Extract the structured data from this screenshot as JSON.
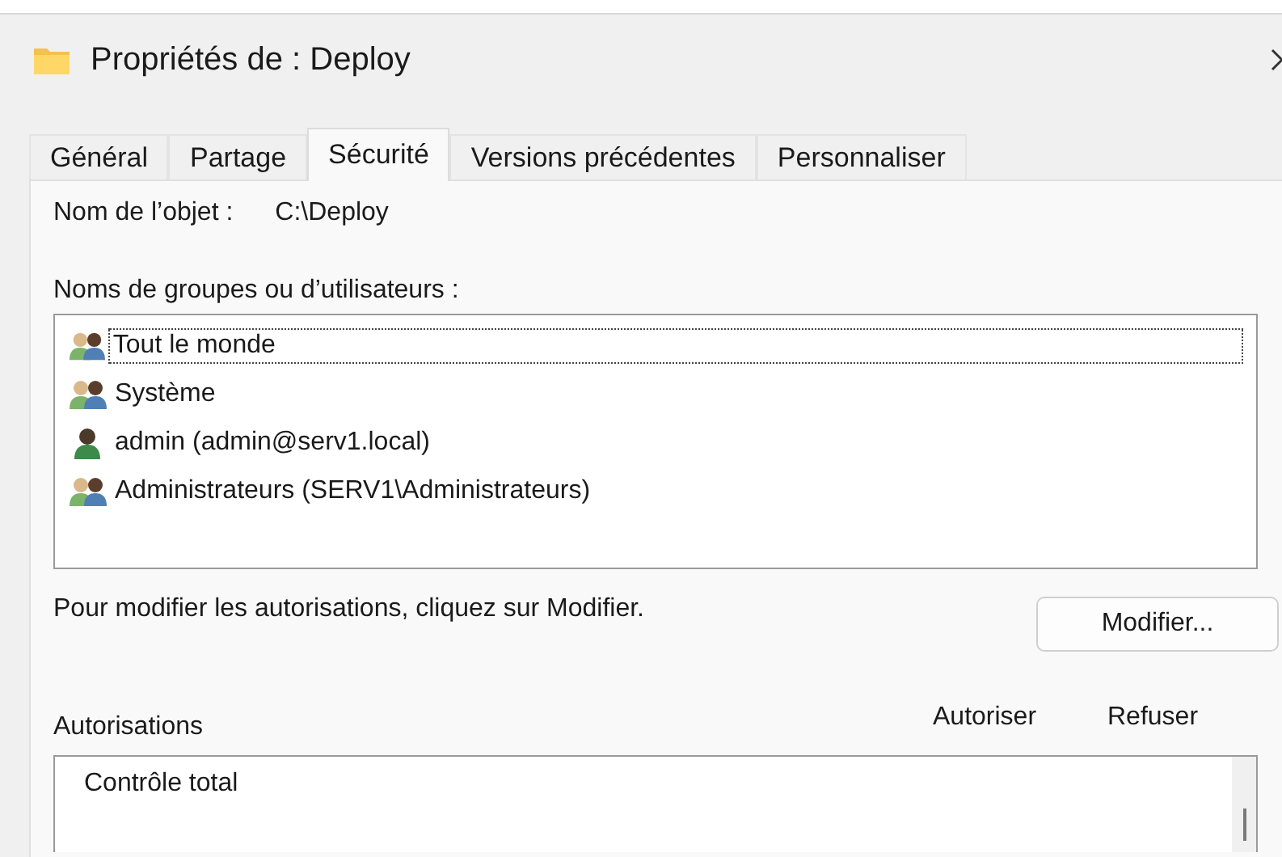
{
  "window": {
    "title": "Propriétés de : Deploy"
  },
  "tabs": [
    {
      "label": "Général",
      "selected": false
    },
    {
      "label": "Partage",
      "selected": false
    },
    {
      "label": "Sécurité",
      "selected": true
    },
    {
      "label": "Versions précédentes",
      "selected": false
    },
    {
      "label": "Personnaliser",
      "selected": false
    }
  ],
  "object_name": {
    "label": "Nom de l’objet :",
    "value": "C:\\Deploy"
  },
  "principals": {
    "label": "Noms de groupes ou d’utilisateurs :",
    "items": [
      {
        "name": "Tout le monde",
        "kind": "group",
        "selected": true
      },
      {
        "name": "Système",
        "kind": "group",
        "selected": false
      },
      {
        "name": "admin (admin@serv1.local)",
        "kind": "user",
        "selected": false
      },
      {
        "name": "Administrateurs (SERV1\\Administrateurs)",
        "kind": "group",
        "selected": false
      }
    ]
  },
  "hint": "Pour modifier les autorisations, cliquez sur Modifier.",
  "edit_button": "Modifier...",
  "permissions": {
    "label": "Autorisations",
    "columns": [
      "Autoriser",
      "Refuser"
    ],
    "rows": [
      {
        "name": "Contrôle total"
      }
    ]
  }
}
